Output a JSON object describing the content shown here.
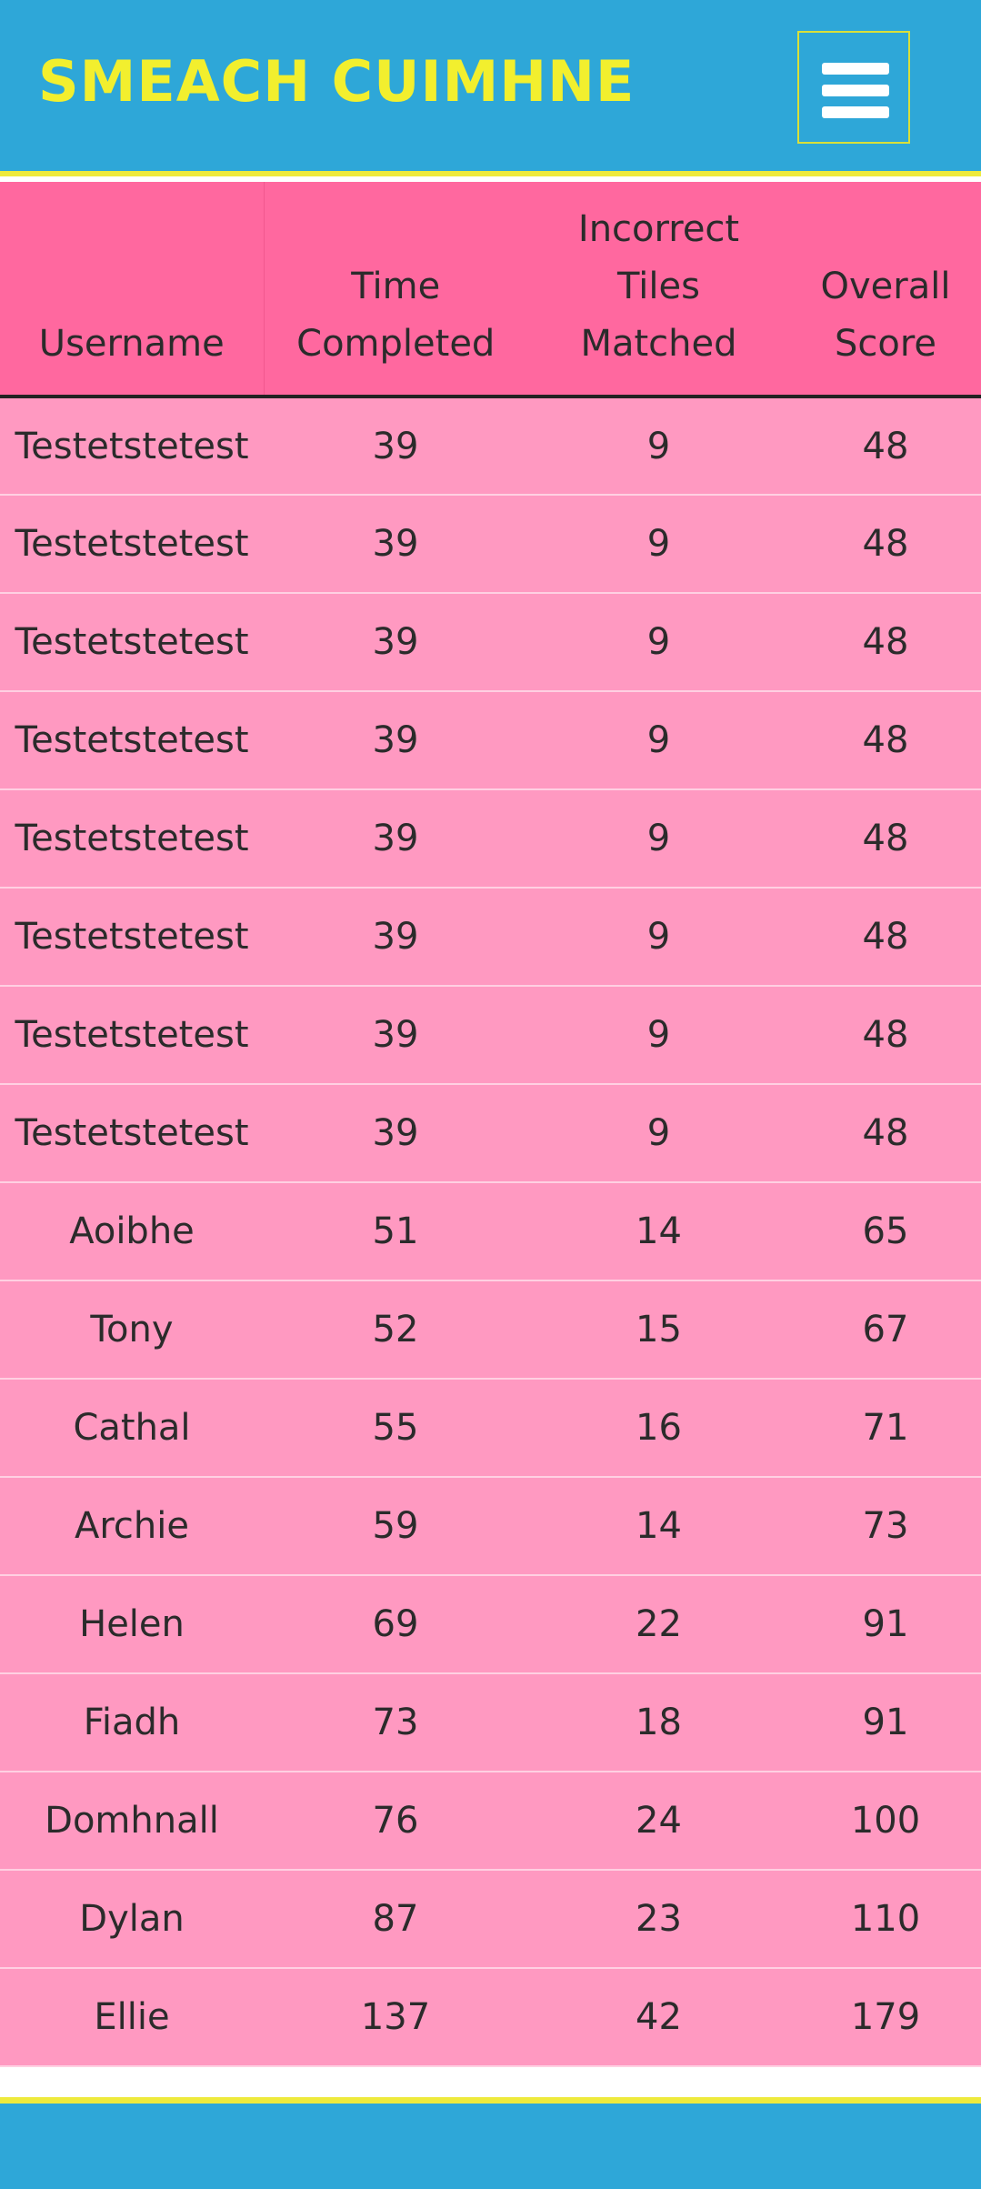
{
  "header": {
    "logo_text": "SMEACH CUIMHNE",
    "menu_icon": "hamburger-menu-icon",
    "colors": {
      "background": "#2ea7d8",
      "logo": "#f2ef2e",
      "accent_line": "#eeea3c"
    }
  },
  "table": {
    "colors": {
      "header_bg": "#ff689f",
      "row_bg": "#ff99c1"
    },
    "columns": {
      "username": "Username",
      "time": [
        "Time",
        "Completed"
      ],
      "incorrect": [
        "Incorrect",
        "Tiles",
        "Matched"
      ],
      "score": [
        "Overall",
        "Score"
      ]
    },
    "rows": [
      {
        "username": "Testetstetest",
        "time": "39",
        "incorrect": "9",
        "score": "48"
      },
      {
        "username": "Testetstetest",
        "time": "39",
        "incorrect": "9",
        "score": "48"
      },
      {
        "username": "Testetstetest",
        "time": "39",
        "incorrect": "9",
        "score": "48"
      },
      {
        "username": "Testetstetest",
        "time": "39",
        "incorrect": "9",
        "score": "48"
      },
      {
        "username": "Testetstetest",
        "time": "39",
        "incorrect": "9",
        "score": "48"
      },
      {
        "username": "Testetstetest",
        "time": "39",
        "incorrect": "9",
        "score": "48"
      },
      {
        "username": "Testetstetest",
        "time": "39",
        "incorrect": "9",
        "score": "48"
      },
      {
        "username": "Testetstetest",
        "time": "39",
        "incorrect": "9",
        "score": "48"
      },
      {
        "username": "Aoibhe",
        "time": "51",
        "incorrect": "14",
        "score": "65"
      },
      {
        "username": "Tony",
        "time": "52",
        "incorrect": "15",
        "score": "67"
      },
      {
        "username": "Cathal",
        "time": "55",
        "incorrect": "16",
        "score": "71"
      },
      {
        "username": "Archie",
        "time": "59",
        "incorrect": "14",
        "score": "73"
      },
      {
        "username": "Helen",
        "time": "69",
        "incorrect": "22",
        "score": "91"
      },
      {
        "username": "Fiadh",
        "time": "73",
        "incorrect": "18",
        "score": "91"
      },
      {
        "username": "Domhnall",
        "time": "76",
        "incorrect": "24",
        "score": "100"
      },
      {
        "username": "Dylan",
        "time": "87",
        "incorrect": "23",
        "score": "110"
      },
      {
        "username": "Ellie",
        "time": "137",
        "incorrect": "42",
        "score": "179"
      }
    ]
  }
}
